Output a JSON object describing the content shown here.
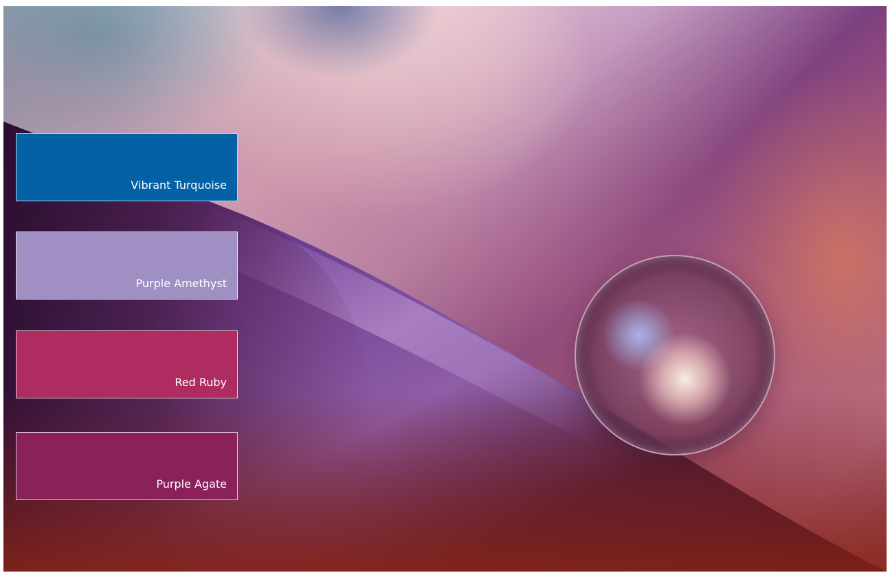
{
  "palette": {
    "swatches": [
      {
        "label": "Vibrant Turquoise",
        "color": "#0561a6"
      },
      {
        "label": "Purple Amethyst",
        "color": "#9f8fc3"
      },
      {
        "label": "Red Ruby",
        "color": "#ae2c60"
      },
      {
        "label": "Purple Agate",
        "color": "#8a2159"
      }
    ]
  },
  "colors": {
    "petal": "#6b3d92",
    "petal_dark": "#2c1030",
    "background_warm": "#c57e8e"
  }
}
